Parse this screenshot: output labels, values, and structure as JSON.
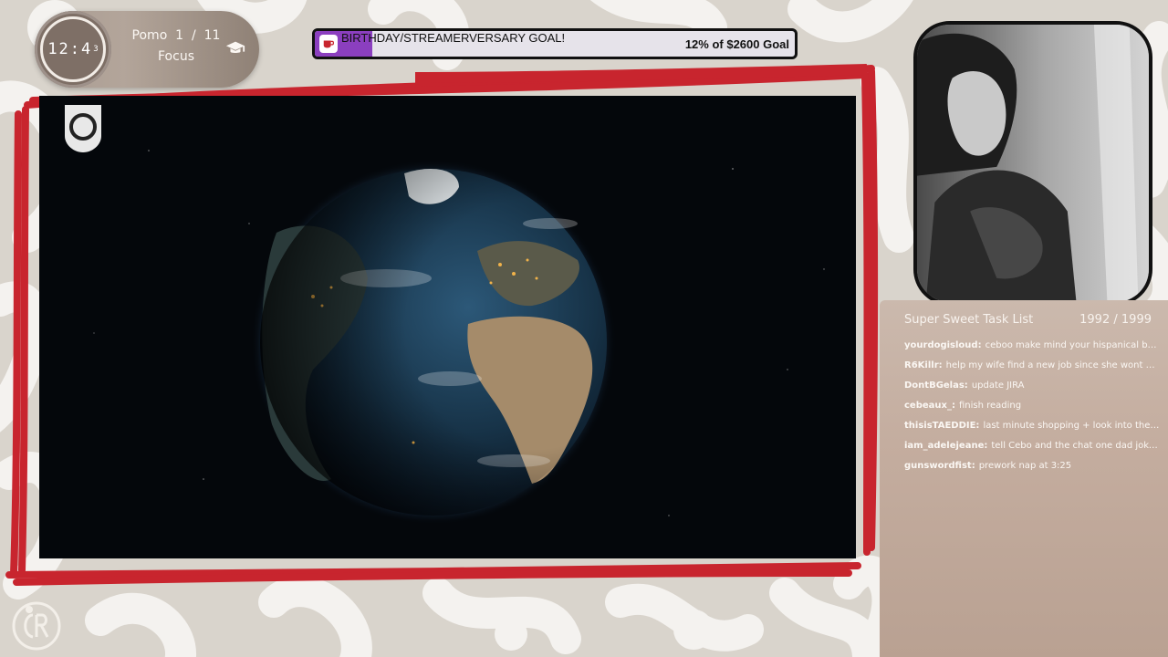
{
  "pomodoro": {
    "time": "12:4",
    "time_small": "3",
    "label": "Pomo",
    "current": "1",
    "separator": "/",
    "total": "11",
    "mode": "Focus",
    "icon": "graduation-cap-icon"
  },
  "goal": {
    "title": "BIRTHDAY/STREAMERVERSARY GOAL!",
    "progress_percent": 12,
    "amount_text": "12% of $2600 Goal",
    "icon": "cup-icon",
    "fill_color": "#8b3fbf"
  },
  "video": {
    "logo_icon": "shield-logo-icon"
  },
  "task_list": {
    "title": "Super Sweet Task List",
    "count_done": "1992",
    "count_sep": "/",
    "count_total": "1999",
    "items": [
      {
        "user": "yourdogisloud:",
        "task": "ceboo make mind your hispanical business"
      },
      {
        "user": "R6Killr:",
        "task": "help my wife find a new job since she wont do it"
      },
      {
        "user": "DontBGelas:",
        "task": "update JIRA"
      },
      {
        "user": "cebeaux_:",
        "task": "finish reading"
      },
      {
        "user": "thisisTAEDDIE:",
        "task": "last minute shopping + look into the matter"
      },
      {
        "user": "iam_adelejeane:",
        "task": "tell Cebo and the chat one dad joke today"
      },
      {
        "user": "gunswordfist:",
        "task": "prework nap at 3:25"
      }
    ]
  },
  "colors": {
    "frame_red": "#c8252e",
    "background": "#d9d4cc"
  }
}
